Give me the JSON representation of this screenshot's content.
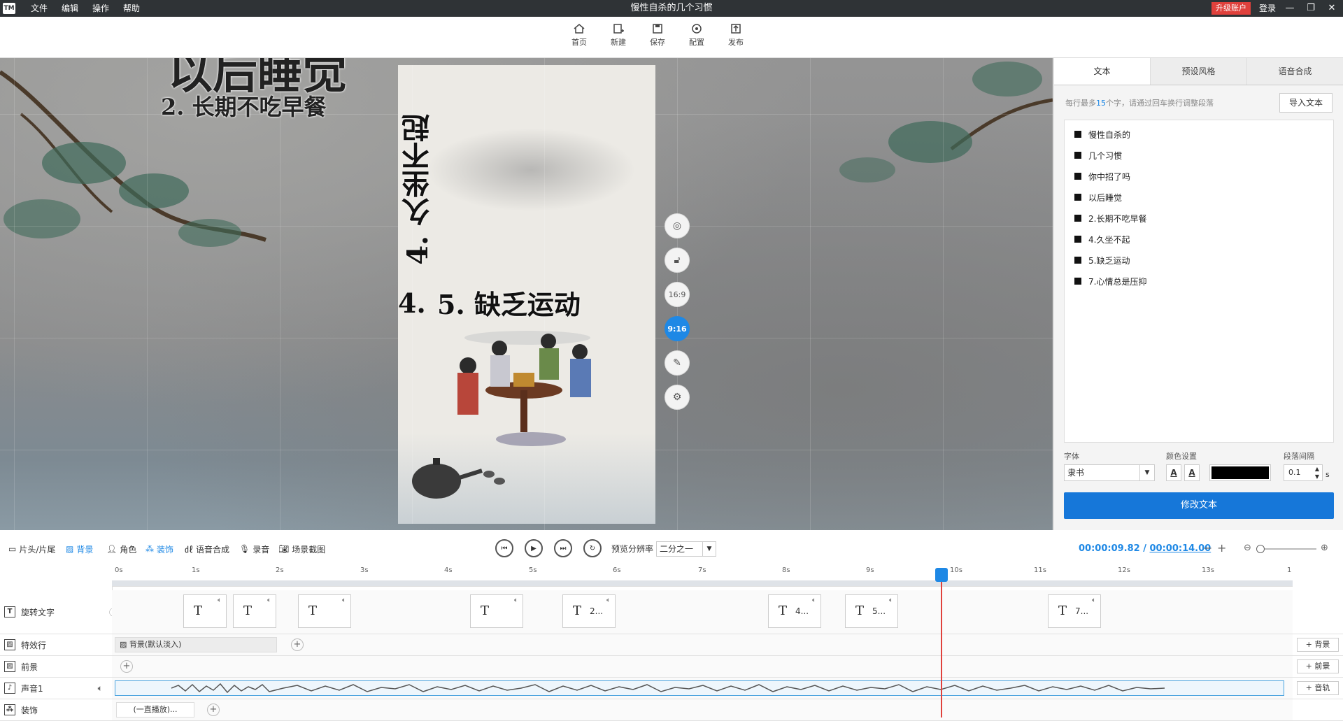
{
  "titlebar": {
    "logo": "TM",
    "menu": [
      "文件",
      "编辑",
      "操作",
      "帮助"
    ],
    "title": "慢性自杀的几个习惯",
    "upgrade": "升级账户",
    "login": "登录"
  },
  "toolbar": {
    "items": [
      {
        "label": "首页",
        "icon": "home-icon"
      },
      {
        "label": "新建",
        "icon": "new-icon"
      },
      {
        "label": "保存",
        "icon": "save-icon"
      },
      {
        "label": "配置",
        "icon": "settings-icon"
      },
      {
        "label": "发布",
        "icon": "publish-icon"
      }
    ]
  },
  "stage": {
    "heading_partial": "以后睡觉",
    "item2": "2. 长期不吃早餐",
    "vertical_text": "4. 久坐不起",
    "item5": "5. 缺乏运动",
    "num4": "4.",
    "ratio_169": "16:9",
    "ratio_916": "9:16"
  },
  "panel": {
    "tabs": [
      "文本",
      "预设风格",
      "语音合成"
    ],
    "hint_pre": "每行最多",
    "hint_num": "15",
    "hint_post": "个字，请通过回车换行调整段落",
    "import": "导入文本",
    "lines": [
      "慢性自杀的",
      "几个习惯",
      "你中招了吗",
      "以后睡觉",
      "2.长期不吃早餐",
      "4.久坐不起",
      "5.缺乏运动",
      "7.心情总是压抑"
    ],
    "font_label": "字体",
    "font_value": "隶书",
    "color_label": "颜色设置",
    "color_value": "#000000",
    "spacing_label": "段落间隔",
    "spacing_value": "0.1",
    "spacing_unit": "s",
    "modify": "修改文本"
  },
  "timeline_bar": {
    "tools": [
      "片头/片尾",
      "背景",
      "角色",
      "装饰",
      "语音合成",
      "录音",
      "场景截图"
    ],
    "active_tool": "背景",
    "res_label": "预览分辨率",
    "res_value": "二分之一",
    "current_time": "00:00:09.82",
    "sep": "/",
    "total_time": "00:00:14.00"
  },
  "ruler": {
    "ticks": [
      "0s",
      "1s",
      "2s",
      "3s",
      "4s",
      "5s",
      "6s",
      "7s",
      "8s",
      "9s",
      "10s",
      "11s",
      "12s",
      "13s",
      "1"
    ]
  },
  "tracks": {
    "rotate_text": {
      "label": "旋转文字",
      "clips": [
        {
          "t": ""
        },
        {
          "t": ""
        },
        {
          "t": ""
        },
        {
          "t": ""
        },
        {
          "t": "2..."
        },
        {
          "t": "4..."
        },
        {
          "t": "5..."
        },
        {
          "t": "7..."
        }
      ]
    },
    "effects": {
      "label": "特效行",
      "clip": "背景(默认淡入)",
      "add": "+ 背景"
    },
    "foreground": {
      "label": "前景",
      "add": "+ 前景"
    },
    "sound": {
      "label": "声音1",
      "add": "+ 音轨"
    },
    "decoration": {
      "label": "装饰",
      "clip": "(一直播放)..."
    }
  }
}
